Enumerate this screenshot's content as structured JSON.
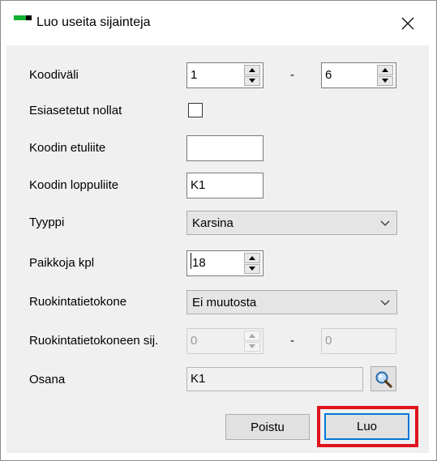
{
  "window": {
    "title": "Luo useita sijainteja"
  },
  "form": {
    "koodivali": {
      "label": "Koodiväli",
      "from": "1",
      "separator": "-",
      "to": "6"
    },
    "esiasetetut": {
      "label": "Esiasetetut nollat",
      "checked": false
    },
    "etuliite": {
      "label": "Koodin etuliite",
      "value": ""
    },
    "loppuliite": {
      "label": "Koodin loppuliite",
      "value": "K1"
    },
    "tyyppi": {
      "label": "Tyyppi",
      "selected": "Karsina"
    },
    "paikkoja": {
      "label": "Paikkoja kpl",
      "value": "18"
    },
    "ruokintatietokone": {
      "label": "Ruokintatietokone",
      "selected": "Ei muutosta"
    },
    "ruokintasij": {
      "label": "Ruokintatietokoneen sij.",
      "from": "0",
      "separator": "-",
      "to": "0"
    },
    "osana": {
      "label": "Osana",
      "value": "K1"
    }
  },
  "buttons": {
    "poistu": "Poistu",
    "luo": "Luo"
  },
  "colors": {
    "highlight": "#e0141e",
    "accent": "#0078d7",
    "icon_green": "#10b030"
  }
}
